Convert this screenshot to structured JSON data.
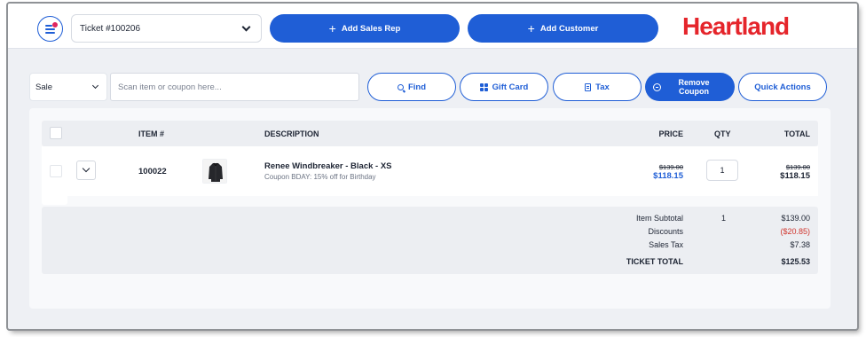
{
  "header": {
    "ticket_label": "Ticket #100206",
    "add_sales_rep": "Add Sales Rep",
    "add_customer": "Add Customer",
    "logo": "Heartland"
  },
  "toolbar": {
    "sale_type": "Sale",
    "scan_placeholder": "Scan item or coupon here...",
    "find": "Find",
    "gift_card": "Gift Card",
    "tax": "Tax",
    "remove_coupon_line1": "Remove",
    "remove_coupon_line2": "Coupon",
    "quick_actions": "Quick Actions"
  },
  "table": {
    "columns": {
      "item": "ITEM #",
      "description": "DESCRIPTION",
      "price": "PRICE",
      "qty": "QTY",
      "total": "TOTAL"
    },
    "rows": [
      {
        "item_number": "100022",
        "description": "Renee Windbreaker - Black - XS",
        "coupon": "Coupon BDAY: 15% off for Birthday",
        "original_price": "$139.00",
        "price": "$118.15",
        "qty": "1",
        "original_total": "$139.00",
        "total": "$118.15"
      }
    ]
  },
  "summary": {
    "subtotal_label": "Item Subtotal",
    "subtotal_qty": "1",
    "subtotal_value": "$139.00",
    "discounts_label": "Discounts",
    "discounts_value": "($20.85)",
    "tax_label": "Sales Tax",
    "tax_value": "$7.38",
    "total_label": "TICKET TOTAL",
    "total_value": "$125.53"
  },
  "colors": {
    "accent": "#1f5ed6",
    "brand": "#e5252b",
    "discount": "#d0342c"
  }
}
